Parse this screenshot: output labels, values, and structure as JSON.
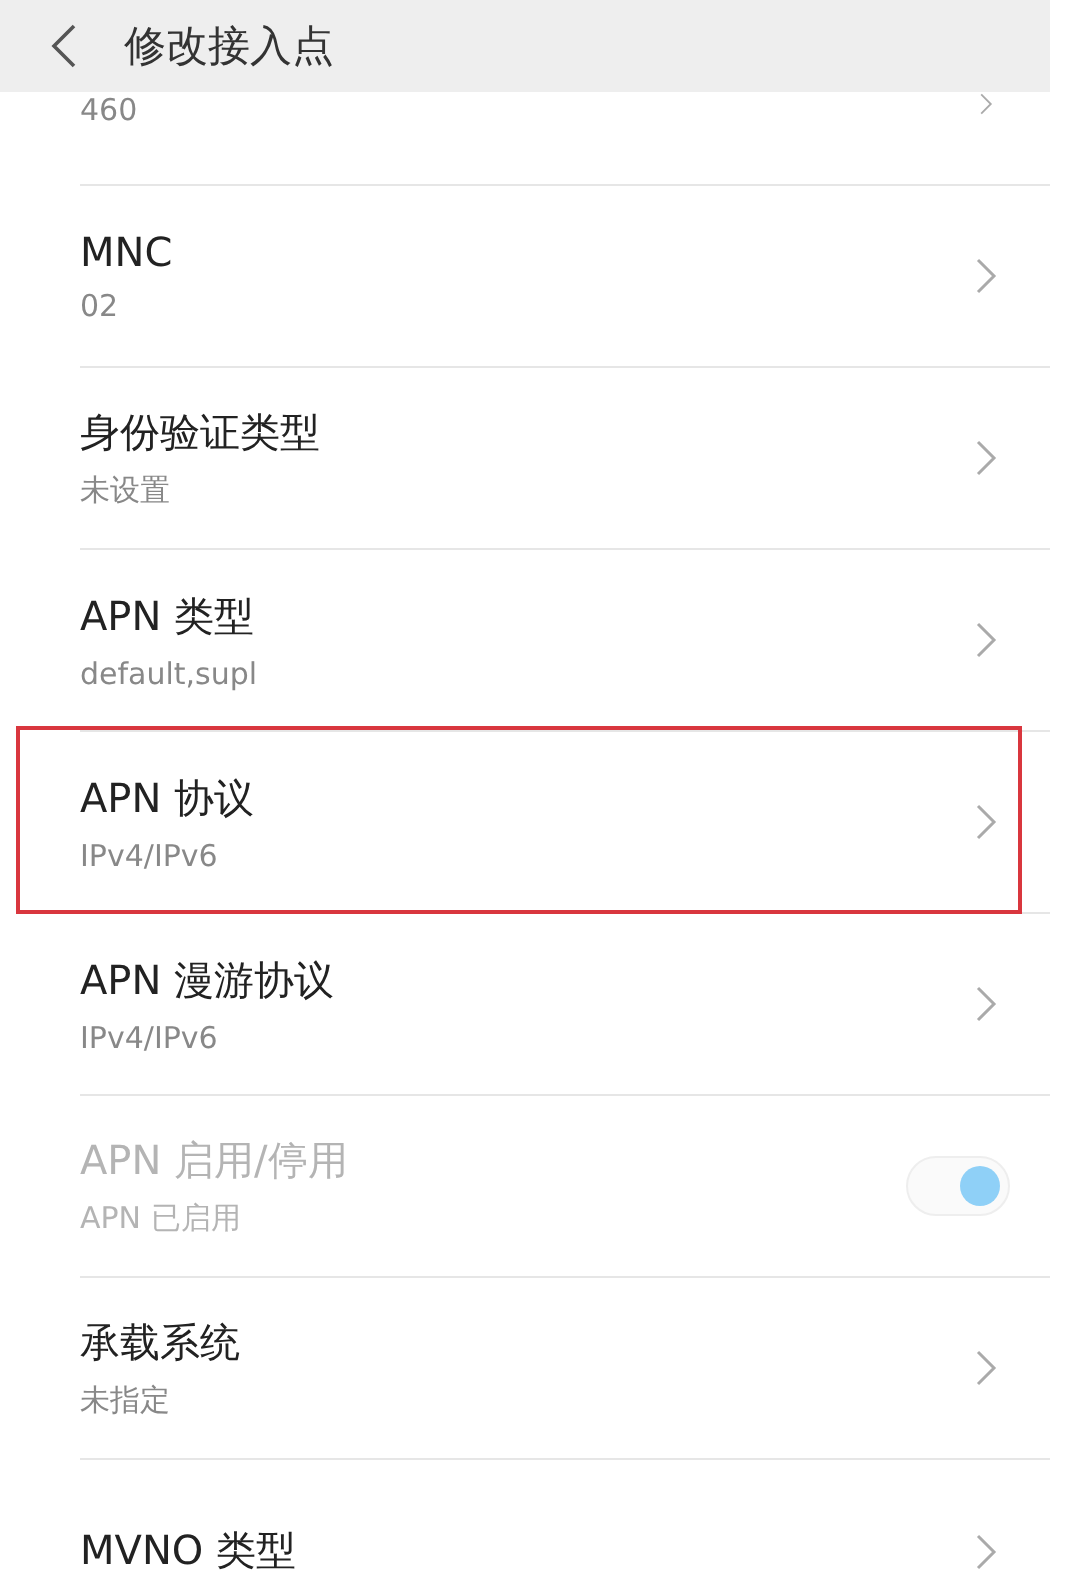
{
  "header": {
    "title": "修改接入点"
  },
  "rows": [
    {
      "kind": "chevron",
      "value": "460",
      "disabled": false,
      "highlighted": false
    },
    {
      "kind": "chevron",
      "title": "MNC",
      "value": "02",
      "disabled": false,
      "highlighted": false
    },
    {
      "kind": "chevron",
      "title": "身份验证类型",
      "value": "未设置",
      "disabled": false,
      "highlighted": false
    },
    {
      "kind": "chevron",
      "title": "APN 类型",
      "value": "default,supl",
      "disabled": false,
      "highlighted": false
    },
    {
      "kind": "chevron",
      "title": "APN 协议",
      "value": "IPv4/IPv6",
      "disabled": false,
      "highlighted": true
    },
    {
      "kind": "chevron",
      "title": "APN 漫游协议",
      "value": "IPv4/IPv6",
      "disabled": false,
      "highlighted": false
    },
    {
      "kind": "toggle",
      "title": "APN 启用/停用",
      "value": "APN 已启用",
      "disabled": true,
      "on": true,
      "highlighted": false
    },
    {
      "kind": "chevron",
      "title": "承载系统",
      "value": "未指定",
      "disabled": false,
      "highlighted": false
    },
    {
      "kind": "chevron",
      "title": "MVNO 类型",
      "disabled": false,
      "highlighted": false
    }
  ]
}
